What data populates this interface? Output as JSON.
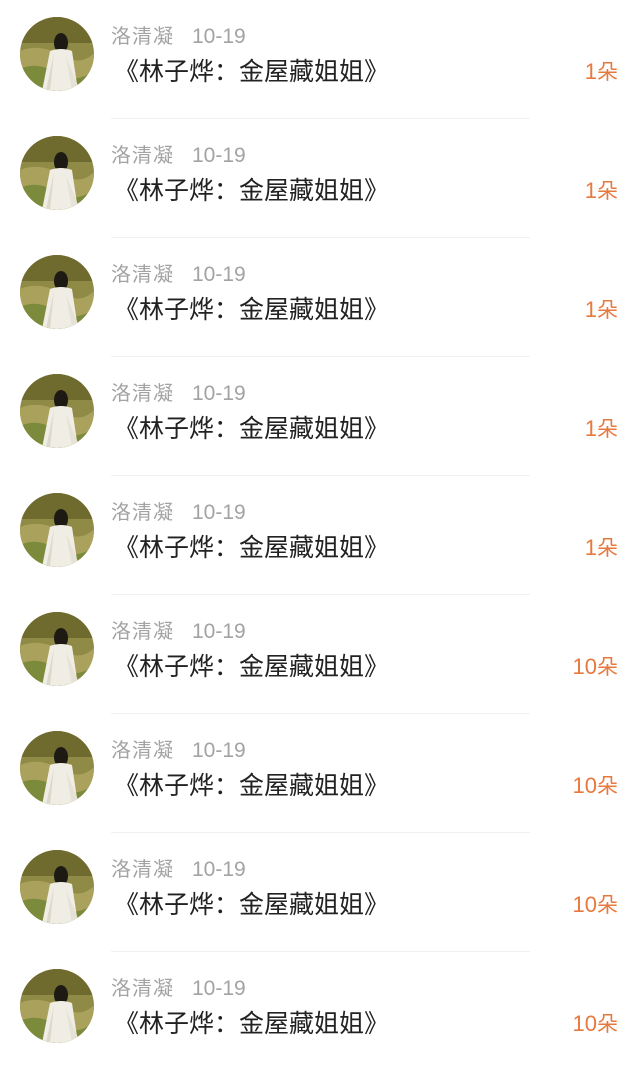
{
  "gift_list": {
    "items": [
      {
        "user_name": "洛清凝",
        "date": "10-19",
        "title": "《林子烨：金屋藏姐姐》",
        "count": "1",
        "unit": "朵"
      },
      {
        "user_name": "洛清凝",
        "date": "10-19",
        "title": "《林子烨：金屋藏姐姐》",
        "count": "1",
        "unit": "朵"
      },
      {
        "user_name": "洛清凝",
        "date": "10-19",
        "title": "《林子烨：金屋藏姐姐》",
        "count": "1",
        "unit": "朵"
      },
      {
        "user_name": "洛清凝",
        "date": "10-19",
        "title": "《林子烨：金屋藏姐姐》",
        "count": "1",
        "unit": "朵"
      },
      {
        "user_name": "洛清凝",
        "date": "10-19",
        "title": "《林子烨：金屋藏姐姐》",
        "count": "1",
        "unit": "朵"
      },
      {
        "user_name": "洛清凝",
        "date": "10-19",
        "title": "《林子烨：金屋藏姐姐》",
        "count": "10",
        "unit": "朵"
      },
      {
        "user_name": "洛清凝",
        "date": "10-19",
        "title": "《林子烨：金屋藏姐姐》",
        "count": "10",
        "unit": "朵"
      },
      {
        "user_name": "洛清凝",
        "date": "10-19",
        "title": "《林子烨：金屋藏姐姐》",
        "count": "10",
        "unit": "朵"
      },
      {
        "user_name": "洛清凝",
        "date": "10-19",
        "title": "《林子烨：金屋藏姐姐》",
        "count": "10",
        "unit": "朵"
      }
    ]
  },
  "colors": {
    "meta_text": "#a3a3a3",
    "title_text": "#222222",
    "count_accent": "#e8793e",
    "divider": "#f1f1f1"
  },
  "icons": {
    "avatar": "avatar-image"
  }
}
